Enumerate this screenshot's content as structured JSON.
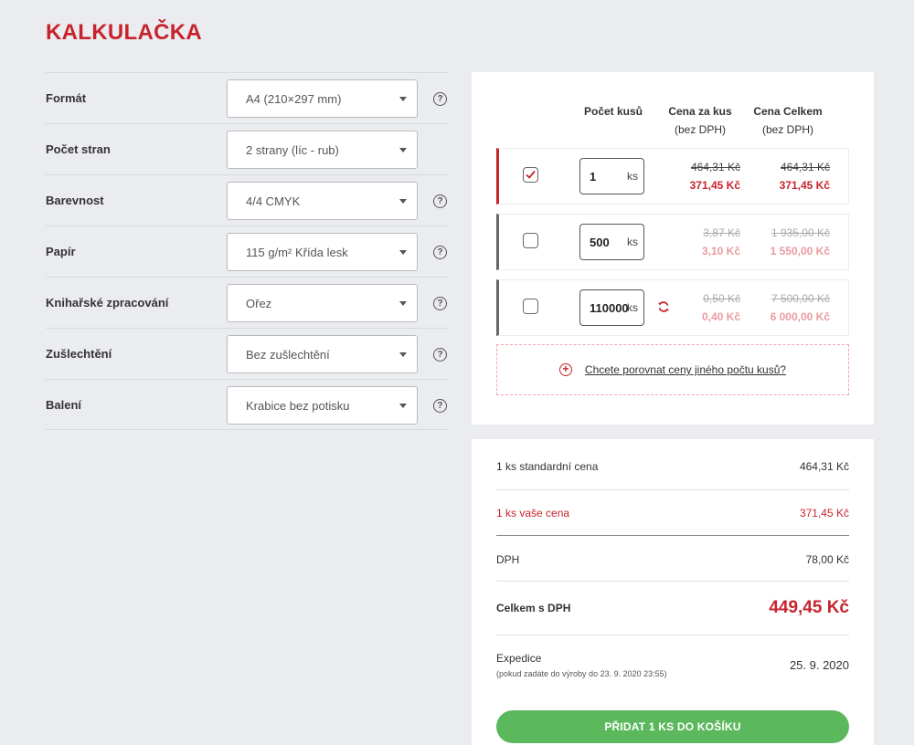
{
  "page_title": "KALKULAČKA",
  "form": {
    "rows": [
      {
        "label": "Formát",
        "value": "A4 (210×297 mm)",
        "help": true
      },
      {
        "label": "Počet stran",
        "value": "2 strany (líc - rub)",
        "help": false
      },
      {
        "label": "Barevnost",
        "value": "4/4 CMYK",
        "help": true
      },
      {
        "label": "Papír",
        "value": "115 g/m² Křída lesk",
        "help": true
      },
      {
        "label": "Knihařské zpracování",
        "value": "Ořez",
        "help": true
      },
      {
        "label": "Zušlechtění",
        "value": "Bez zušlechtění",
        "help": true
      },
      {
        "label": "Balení",
        "value": "Krabice bez potisku",
        "help": true
      }
    ],
    "help_glyph": "?"
  },
  "table": {
    "col_qty": "Počet kusů",
    "col_unit": "Cena za kus",
    "col_unit_sub": "(bez DPH)",
    "col_total": "Cena Celkem",
    "col_total_sub": "(bez DPH)",
    "rows": [
      {
        "checked": true,
        "qty": "1",
        "unit": "ks",
        "unit_old": "464,31 Kč",
        "unit_new": "371,45 Kč",
        "total_old": "464,31 Kč",
        "total_new": "371,45 Kč"
      },
      {
        "checked": false,
        "qty": "500",
        "unit": "ks",
        "unit_old": "3,87 Kč",
        "unit_new": "3,10 Kč",
        "total_old": "1 935,00 Kč",
        "total_new": "1 550,00 Kč"
      },
      {
        "checked": false,
        "qty": "110000",
        "unit": "ks",
        "unit_old": "0,50 Kč",
        "unit_new": "0,40 Kč",
        "total_old": "7 500,00 Kč",
        "total_new": "6 000,00 Kč"
      }
    ],
    "compare_plus": "+",
    "compare_link": "Chcete porovnat ceny jiného počtu kusů?"
  },
  "summary": {
    "std_label": "1 ks standardní cena",
    "std_value": "464,31 Kč",
    "your_label": "1 ks vaše cena",
    "your_value": "371,45 Kč",
    "vat_label": "DPH",
    "vat_value": "78,00 Kč",
    "total_label": "Celkem s DPH",
    "total_value": "449,45 Kč",
    "exp_label": "Expedice",
    "exp_note": "(pokud zadáte do výroby do 23. 9. 2020 23:55)",
    "exp_value": "25. 9. 2020",
    "add_button": "PŘIDAT 1 KS DO KOŠÍKU"
  },
  "colors": {
    "accent": "#c8232d",
    "button": "#5cb85c",
    "background": "#ebecf0"
  }
}
